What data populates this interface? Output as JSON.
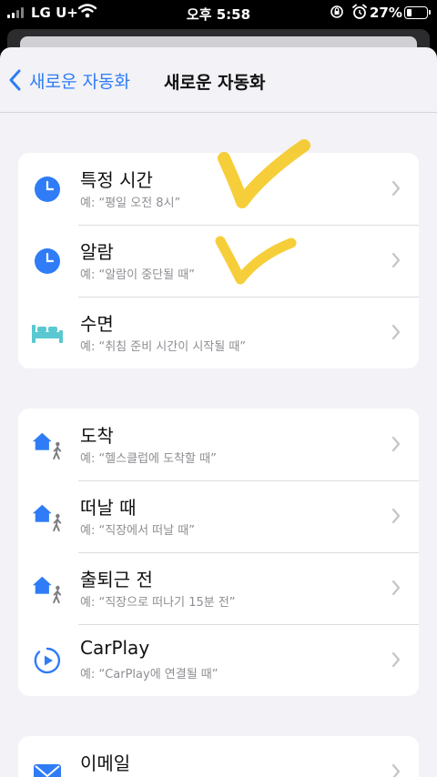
{
  "status_bar": {
    "carrier": "LG U+",
    "time": "오후 5:58",
    "battery_pct": "27%",
    "battery_level": 0.27,
    "icons": [
      "signal-icon",
      "wifi-icon",
      "rotation-lock-icon",
      "alarm-icon",
      "battery-icon"
    ]
  },
  "nav": {
    "back_label": "새로운 자동화",
    "title": "새로운 자동화"
  },
  "groups": [
    {
      "rows": [
        {
          "title": "특정 시간",
          "subtitle": "예: “평일 오전 8시”",
          "icon": "clock-icon"
        },
        {
          "title": "알람",
          "subtitle": "예: “알람이 중단될 때”",
          "icon": "clock-icon"
        },
        {
          "title": "수면",
          "subtitle": "예: “취침 준비 시간이 시작될 때”",
          "icon": "bed-icon"
        }
      ]
    },
    {
      "rows": [
        {
          "title": "도착",
          "subtitle": "예: “헬스클럽에 도착할 때”",
          "icon": "home-walk-icon"
        },
        {
          "title": "떠날 때",
          "subtitle": "예: “직장에서 떠날 때”",
          "icon": "home-walk-icon"
        },
        {
          "title": "출퇴근 전",
          "subtitle": "예: “직장으로 떠나기 15분 전”",
          "icon": "home-walk-icon"
        },
        {
          "title": "CarPlay",
          "subtitle": "예: “CarPlay에 연결될 때”",
          "icon": "carplay-icon"
        }
      ]
    },
    {
      "rows": [
        {
          "title": "이메일",
          "subtitle": "",
          "icon": "mail-icon"
        }
      ]
    }
  ],
  "colors": {
    "accent": "#2f7cf6",
    "background": "#f2f2f7",
    "bed": "#5ac8d0",
    "checkmark": "#f5c518"
  }
}
